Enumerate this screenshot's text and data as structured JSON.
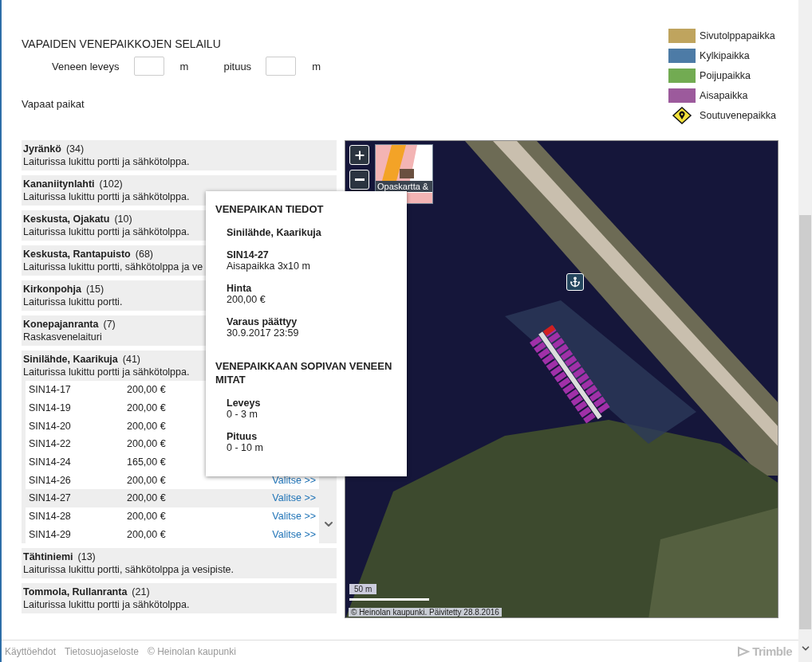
{
  "title": "VAPAIDEN VENEPAIKKOJEN SELAILU",
  "filters": [
    {
      "label": "Veneen leveys",
      "unit": "m"
    },
    {
      "label": "pituus",
      "unit": "m"
    }
  ],
  "list_heading": "Vapaat paikat",
  "legend": [
    {
      "kind": "swatch",
      "label": "Sivutolppapaikka",
      "color": "#bfa45e"
    },
    {
      "kind": "swatch",
      "label": "Kylkipaikka",
      "color": "#4d7ba6"
    },
    {
      "kind": "swatch",
      "label": "Poijupaikka",
      "color": "#72ab52"
    },
    {
      "kind": "swatch",
      "label": "Aisapaikka",
      "color": "#9c5a9c"
    },
    {
      "kind": "marker",
      "label": "Soutuvenepaikka"
    }
  ],
  "harbours": [
    {
      "name": "Jyränkö",
      "count": "(34)",
      "description": "Laiturissa lukittu portti ja sähkötolppa."
    },
    {
      "name": "Kananiitynlahti",
      "count": "(102)",
      "description": "Laiturissa lukittu portti ja sähkötolppa."
    },
    {
      "name": "Keskusta, Ojakatu",
      "count": "(10)",
      "description": "Laiturissa lukittu portti ja sähkötolppa."
    },
    {
      "name": "Keskusta, Rantapuisto",
      "count": "(68)",
      "description": "Laiturissa lukittu portti, sähkötolppa ja ve"
    },
    {
      "name": "Kirkonpohja",
      "count": "(15)",
      "description": "Laiturissa lukittu portti."
    },
    {
      "name": "Konepajanranta",
      "count": "(7)",
      "description": "Raskasvenelaituri"
    },
    {
      "name": "Sinilähde, Kaarikuja",
      "count": "(41)",
      "description": "Laiturissa lukittu portti ja sähkötolppa.",
      "berths": [
        {
          "id": "SIN14-17",
          "price": "200,00 €",
          "selected": false
        },
        {
          "id": "SIN14-19",
          "price": "200,00 €",
          "selected": false
        },
        {
          "id": "SIN14-20",
          "price": "200,00 €",
          "selected": false
        },
        {
          "id": "SIN14-22",
          "price": "200,00 €",
          "selected": false
        },
        {
          "id": "SIN14-24",
          "price": "165,00 €",
          "selected": false
        },
        {
          "id": "SIN14-26",
          "price": "200,00 €",
          "action": "Valitse >>",
          "selected": false
        },
        {
          "id": "SIN14-27",
          "price": "200,00 €",
          "action": "Valitse >>",
          "selected": true
        },
        {
          "id": "SIN14-28",
          "price": "200,00 €",
          "action": "Valitse >>",
          "selected": false
        },
        {
          "id": "SIN14-29",
          "price": "200,00 €",
          "action": "Valitse >>",
          "selected": false
        }
      ]
    },
    {
      "name": "Tähtiniemi",
      "count": "(13)",
      "description": "Laiturissa lukittu portti, sähkötolppa ja vesipiste."
    },
    {
      "name": "Tommola, Rullanranta",
      "count": "(21)",
      "description": "Laiturissa lukittu portti ja sähkötolppa."
    }
  ],
  "popup": {
    "title": "VENEPAIKAN TIEDOT",
    "harbour": "Sinilähde, Kaarikuja",
    "berth_id": "SIN14-27",
    "berth_type": "Aisapaikka 3x10 m",
    "fields": [
      {
        "label": "Hinta",
        "value": "200,00 €"
      },
      {
        "label": "Varaus päättyy",
        "value": "30.9.2017 23:59"
      }
    ],
    "size_title": "VENEPAIKKAAN SOPIVAN VENEEN MITAT",
    "size_fields": [
      {
        "label": "Leveys",
        "value": "0 - 3 m"
      },
      {
        "label": "Pituus",
        "value": "0 - 10 m"
      }
    ]
  },
  "map": {
    "layer_label": "Opaskartta &",
    "scale": "50 m",
    "attribution": "© Heinolan kaupunki. Päivitetty 28.8.2016"
  },
  "footer": {
    "links": [
      "Käyttöehdot",
      "Tietosuojaseloste"
    ],
    "copyright": "© Heinolan kaupunki",
    "logo": "Trimble"
  }
}
